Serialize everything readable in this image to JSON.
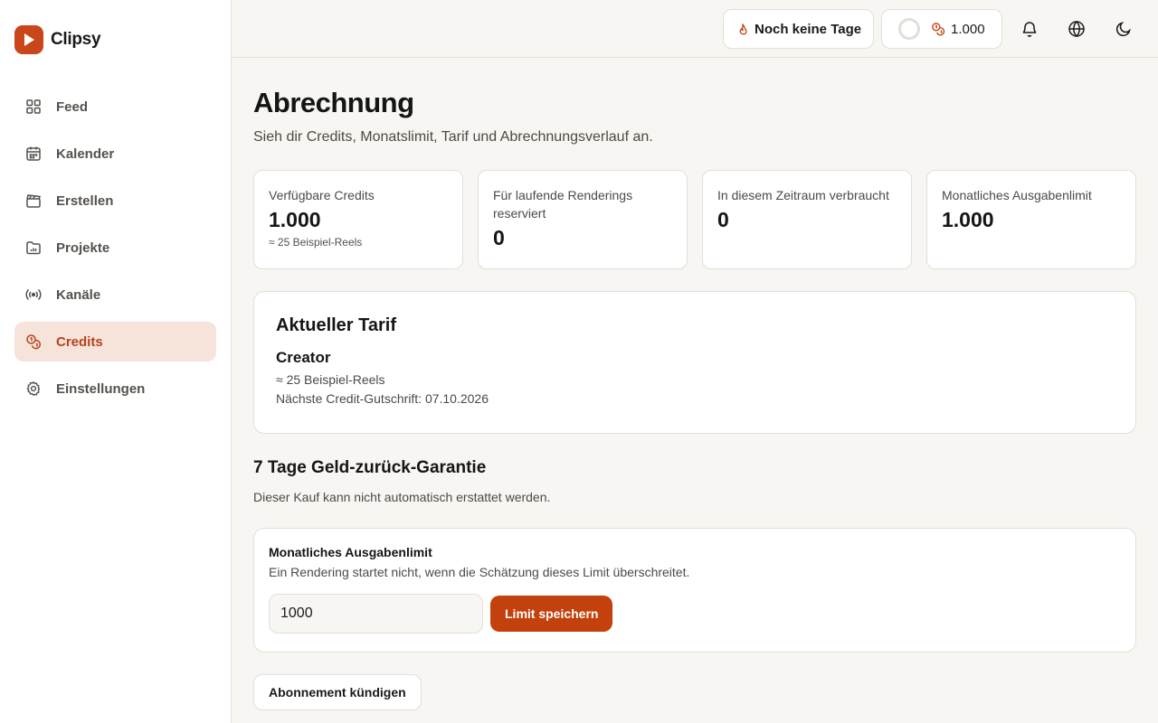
{
  "brand": {
    "name": "Clipsy"
  },
  "sidebar": {
    "items": [
      {
        "label": "Feed",
        "icon": "grid-icon"
      },
      {
        "label": "Kalender",
        "icon": "calendar-icon"
      },
      {
        "label": "Erstellen",
        "icon": "clapperboard-icon"
      },
      {
        "label": "Projekte",
        "icon": "folder-chart-icon"
      },
      {
        "label": "Kanäle",
        "icon": "broadcast-icon"
      },
      {
        "label": "Credits",
        "icon": "coins-icon",
        "active": true
      },
      {
        "label": "Einstellungen",
        "icon": "gear-icon"
      }
    ]
  },
  "topbar": {
    "streak_label": "Noch keine Tage",
    "credits_value": "1.000",
    "icons": [
      "bell-icon",
      "globe-icon",
      "moon-icon"
    ]
  },
  "page": {
    "title": "Abrechnung",
    "subtitle": "Sieh dir Credits, Monatslimit, Tarif und Abrechnungsverlauf an."
  },
  "stats": [
    {
      "label": "Verfügbare Credits",
      "value": "1.000",
      "note": "≈ 25 Beispiel-Reels"
    },
    {
      "label": "Für laufende Renderings reserviert",
      "value": "0"
    },
    {
      "label": "In diesem Zeitraum verbraucht",
      "value": "0"
    },
    {
      "label": "Monatliches Ausgabenlimit",
      "value": "1.000"
    }
  ],
  "plan": {
    "heading": "Aktueller Tarif",
    "name": "Creator",
    "reels": "≈ 25 Beispiel-Reels",
    "next_credit": "Nächste Credit-Gutschrift: 07.10.2026"
  },
  "guarantee": {
    "title": "7 Tage Geld-zurück-Garantie",
    "subtitle": "Dieser Kauf kann nicht automatisch erstattet werden."
  },
  "limit": {
    "title": "Monatliches Ausgabenlimit",
    "description": "Ein Rendering startet nicht, wenn die Schätzung dieses Limit überschreitet.",
    "input_value": "1000",
    "save_label": "Limit speichern"
  },
  "cancel_label": "Abonnement kündigen",
  "colors": {
    "accent": "#c2410c",
    "active_bg": "#f6e3da",
    "background": "#f8f6f2"
  }
}
